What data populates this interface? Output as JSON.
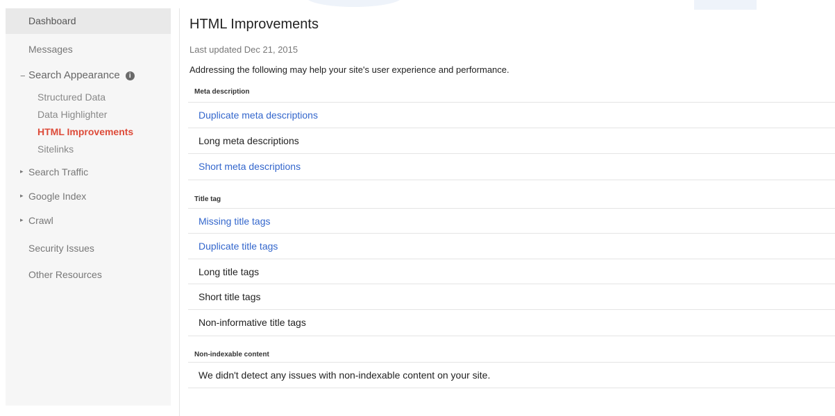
{
  "sidebar": {
    "dashboard": "Dashboard",
    "messages": "Messages",
    "search_appearance": {
      "caret": "−",
      "label": "Search Appearance",
      "info_icon": "info-icon"
    },
    "search_appearance_items": [
      "Structured Data",
      "Data Highlighter",
      "HTML Improvements",
      "Sitelinks"
    ],
    "search_traffic": {
      "caret": "▸",
      "label": "Search Traffic"
    },
    "google_index": {
      "caret": "▸",
      "label": "Google Index"
    },
    "crawl": {
      "caret": "▸",
      "label": "Crawl"
    },
    "security_issues": "Security Issues",
    "other_resources": "Other Resources",
    "selected_color": "#dd4b39"
  },
  "main": {
    "title": "HTML Improvements",
    "last_updated": "Last updated Dec 21, 2015",
    "intro": "Addressing the following may help your site's user experience and performance.",
    "sections": [
      {
        "heading": "Meta description",
        "items": [
          {
            "label": "Duplicate meta descriptions",
            "link": true
          },
          {
            "label": "Long meta descriptions",
            "link": false
          },
          {
            "label": "Short meta descriptions",
            "link": true
          }
        ]
      },
      {
        "heading": "Title tag",
        "items": [
          {
            "label": "Missing title tags",
            "link": true
          },
          {
            "label": "Duplicate title tags",
            "link": true
          },
          {
            "label": "Long title tags",
            "link": false
          },
          {
            "label": "Short title tags",
            "link": false
          },
          {
            "label": "Non-informative title tags",
            "link": false
          }
        ]
      },
      {
        "heading": "Non-indexable content",
        "items": [
          {
            "label": "We didn't detect any issues with non-indexable content on your site.",
            "link": false
          }
        ]
      }
    ],
    "link_color": "#3366cc"
  }
}
